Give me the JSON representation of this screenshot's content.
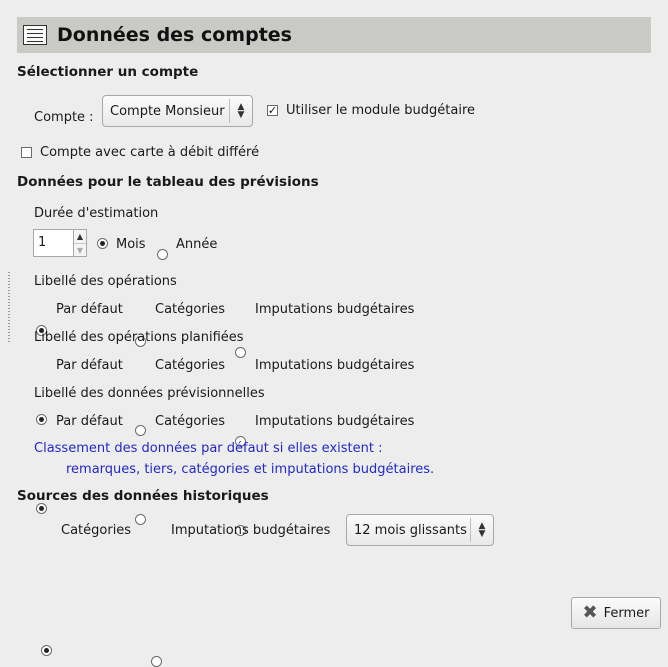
{
  "header": {
    "title": "Données des comptes",
    "icon": "table-icon"
  },
  "select_account": {
    "section_title": "Sélectionner un compte",
    "account_label": "Compte :",
    "account_value": "Compte Monsieur",
    "budget_module_label": "Utiliser le module budgétaire",
    "budget_module_checked": true,
    "deferred_debit_label": "Compte avec carte à débit différé",
    "deferred_debit_checked": false
  },
  "forecast": {
    "section_title": "Données pour le tableau des prévisions",
    "duration_label": "Durée d'estimation",
    "duration_value": "1",
    "unit_month": "Mois",
    "unit_year": "Année",
    "selected_unit": "month",
    "groups": [
      {
        "label": "Libellé des opérations",
        "options": [
          "Par défaut",
          "Catégories",
          "Imputations budgétaires"
        ],
        "selected": 0
      },
      {
        "label": "Libellé des opérations planifiées",
        "options": [
          "Par défaut",
          "Catégories",
          "Imputations budgétaires"
        ],
        "selected": 0
      },
      {
        "label": "Libellé des données prévisionnelles",
        "options": [
          "Par défaut",
          "Catégories",
          "Imputations budgétaires"
        ],
        "selected": 0
      }
    ],
    "note_line1": "Classement des données par défaut si elles existent :",
    "note_line2": "remarques, tiers, catégories et imputations budgétaires."
  },
  "history": {
    "section_title": "Sources des données historiques",
    "option_categories": "Catégories",
    "option_budget": "Imputations budgétaires",
    "selected": 0,
    "period_value": "12 mois glissants"
  },
  "footer": {
    "close_label": "Fermer"
  },
  "colors": {
    "header_bg": "#c9c9c6",
    "note_text": "#2328c8",
    "window_bg": "#ededed"
  }
}
